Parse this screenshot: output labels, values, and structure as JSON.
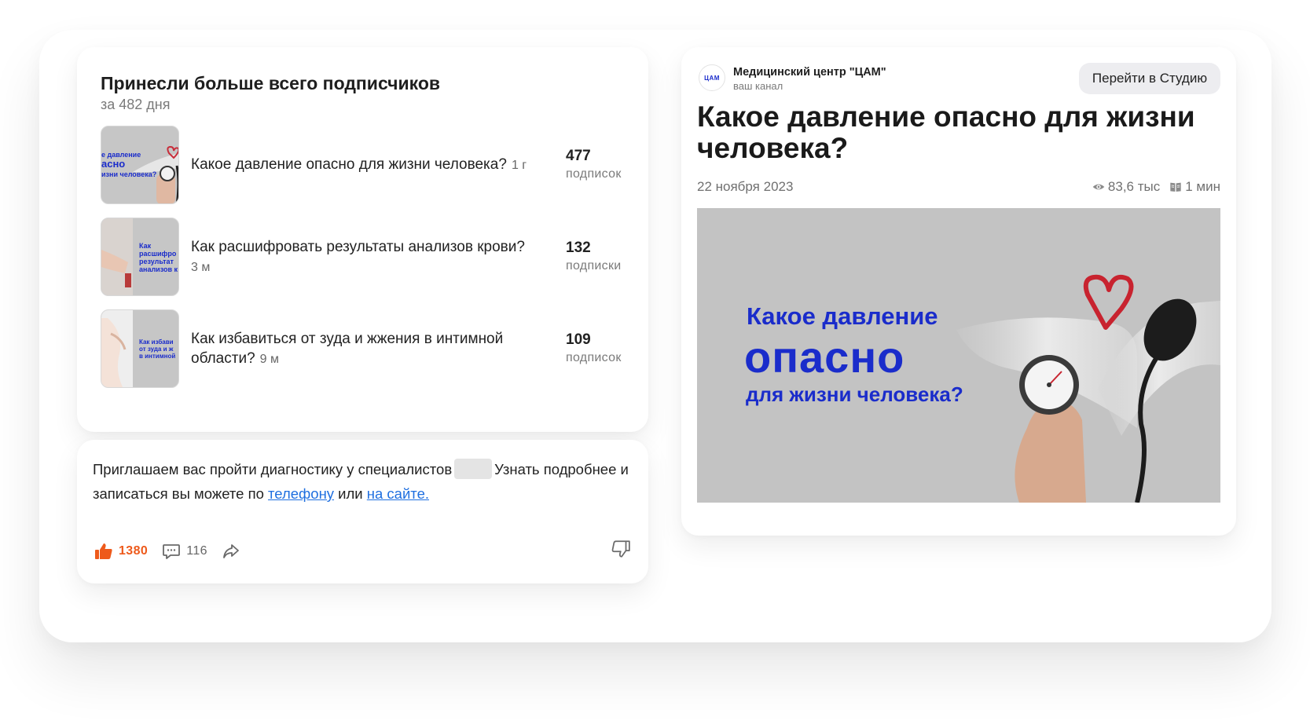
{
  "top_posts": {
    "title": "Принесли больше всего подписчиков",
    "subtitle": "за 482 дня",
    "items": [
      {
        "title": "Какое давление опасно для жизни человека?",
        "age": "1 г",
        "count": "477",
        "count_label": "подписок",
        "thumb_text_1": "е давление",
        "thumb_text_2": "асно",
        "thumb_text_3": "изни человека?"
      },
      {
        "title": "Как расшифровать результаты анализов крови?",
        "age": "3 м",
        "count": "132",
        "count_label": "подписки",
        "thumb_text_1": "Как",
        "thumb_text_2": "расшифро",
        "thumb_text_3": "результат",
        "thumb_text_4": "анализов к"
      },
      {
        "title": "Как избавиться от зуда и жжения в интимной области?",
        "age": "9 м",
        "count": "109",
        "count_label": "подписок",
        "thumb_text_1": "Как избави",
        "thumb_text_2": "от зуда и ж",
        "thumb_text_3": "в интимной"
      }
    ]
  },
  "post": {
    "text_before": "Приглашаем вас пройти диагностику у специалистов",
    "text_middle": "Узнать подробнее и записаться вы можете по",
    "link_phone": "телефону",
    "text_or": "или",
    "link_site": "на сайте.",
    "likes": "1380",
    "comments": "116",
    "colors": {
      "like": "#ee5a1b",
      "link": "#1f6fe0"
    }
  },
  "article": {
    "channel_name": "Медицинский центр \"ЦАМ\"",
    "channel_sub": "ваш канал",
    "avatar_text": "ЦАМ",
    "studio_button": "Перейти в Студию",
    "title": "Какое давление опасно для жизни человека?",
    "date": "22 ноября 2023",
    "views": "83,6 тыс",
    "read_time": "1 мин",
    "cover": {
      "line1": "Какое давление",
      "line2": "опасно",
      "line3": "для жизни человека?"
    },
    "colors": {
      "accent": "#1a2ccb"
    }
  }
}
